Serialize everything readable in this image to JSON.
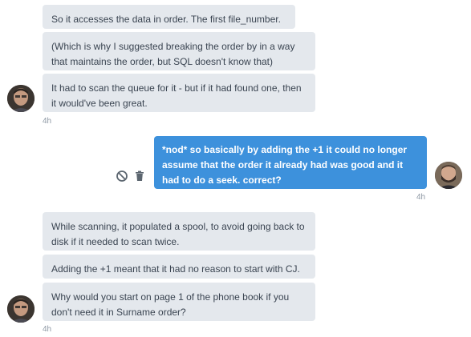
{
  "messages_group_1": [
    "So it accesses the data in order. The first file_number.",
    "(Which is why I suggested breaking the order by in a way that maintains the order, but SQL doesn't know that)",
    "It had to scan the queue for it - but if it had found one, then it would've been great."
  ],
  "group_1_time": "4h",
  "my_message": "*nod* so basically by adding the +1 it could no longer assume that the order it already had was good and it had to do a seek. correct?",
  "my_time": "4h",
  "messages_group_2": [
    "While scanning, it populated a spool, to avoid going back to disk if it needed to scan twice.",
    "Adding the +1 meant that it had no reason to start with CJ.",
    "Why would you start on page 1 of the phone book if you don't need it in Surname order?"
  ],
  "group_2_time": "4h",
  "icons": {
    "cancel": "cancel-icon",
    "delete": "trash-icon"
  },
  "colors": {
    "other_bubble": "#e4e8ed",
    "my_bubble": "#3d91dc",
    "timestamp": "#8e98a4"
  }
}
